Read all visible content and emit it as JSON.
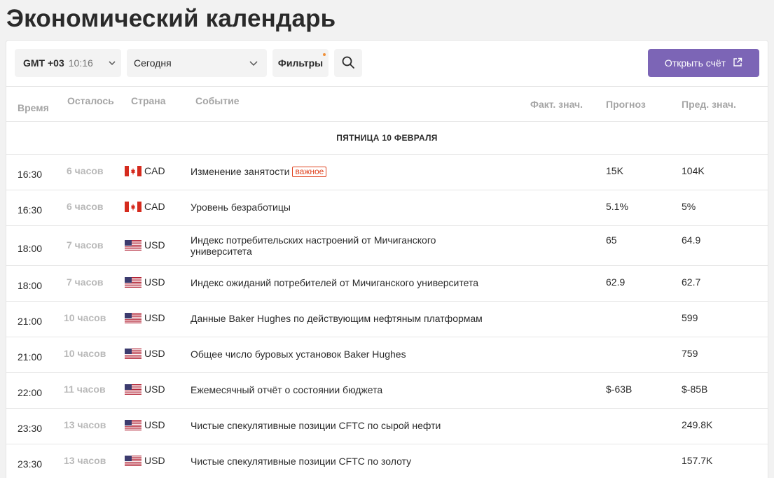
{
  "page": {
    "title": "Экономический календарь"
  },
  "toolbar": {
    "timezone_label": "GMT +03",
    "timezone_time": "10:16",
    "period_value": "Сегодня",
    "filters_label": "Фильтры",
    "open_account_label": "Открыть счёт",
    "accent_color": "#7c65b6"
  },
  "table": {
    "headers": {
      "time": "Время",
      "left": "Осталось",
      "country": "Страна",
      "event": "Событие",
      "actual": "Факт. знач.",
      "forecast": "Прогноз",
      "previous": "Пред. знач."
    },
    "date_label": "ПЯТНИЦА 10 ФЕВРАЛЯ",
    "rows": [
      {
        "time": "16:30",
        "left": "6 часов",
        "flag": "canada-flag-icon",
        "currency": "CAD",
        "event": "Изменение занятости",
        "badge": "важное",
        "actual": "",
        "forecast": "15K",
        "previous": "104K"
      },
      {
        "time": "16:30",
        "left": "6 часов",
        "flag": "canada-flag-icon",
        "currency": "CAD",
        "event": "Уровень безработицы",
        "badge": "",
        "actual": "",
        "forecast": "5.1%",
        "previous": "5%"
      },
      {
        "time": "18:00",
        "left": "7 часов",
        "flag": "usa-flag-icon",
        "currency": "USD",
        "event": "Индекс потребительских настроений от Мичиганского университета",
        "badge": "",
        "actual": "",
        "forecast": "65",
        "previous": "64.9"
      },
      {
        "time": "18:00",
        "left": "7 часов",
        "flag": "usa-flag-icon",
        "currency": "USD",
        "event": "Индекс ожиданий потребителей от Мичиганского университета",
        "badge": "",
        "actual": "",
        "forecast": "62.9",
        "previous": "62.7"
      },
      {
        "time": "21:00",
        "left": "10 часов",
        "flag": "usa-flag-icon",
        "currency": "USD",
        "event": "Данные Baker Hughes по действующим нефтяным платформам",
        "badge": "",
        "actual": "",
        "forecast": "",
        "previous": "599"
      },
      {
        "time": "21:00",
        "left": "10 часов",
        "flag": "usa-flag-icon",
        "currency": "USD",
        "event": "Общее число буровых установок Baker Hughes",
        "badge": "",
        "actual": "",
        "forecast": "",
        "previous": "759"
      },
      {
        "time": "22:00",
        "left": "11 часов",
        "flag": "usa-flag-icon",
        "currency": "USD",
        "event": "Ежемесячный отчёт о состоянии бюджета",
        "badge": "",
        "actual": "",
        "forecast": "$-63B",
        "previous": "$-85B"
      },
      {
        "time": "23:30",
        "left": "13 часов",
        "flag": "usa-flag-icon",
        "currency": "USD",
        "event": "Чистые спекулятивные позиции CFTC по сырой нефти",
        "badge": "",
        "actual": "",
        "forecast": "",
        "previous": "249.8K"
      },
      {
        "time": "23:30",
        "left": "13 часов",
        "flag": "usa-flag-icon",
        "currency": "USD",
        "event": "Чистые спекулятивные позиции CFTC по золоту",
        "badge": "",
        "actual": "",
        "forecast": "",
        "previous": "157.7K"
      }
    ]
  }
}
